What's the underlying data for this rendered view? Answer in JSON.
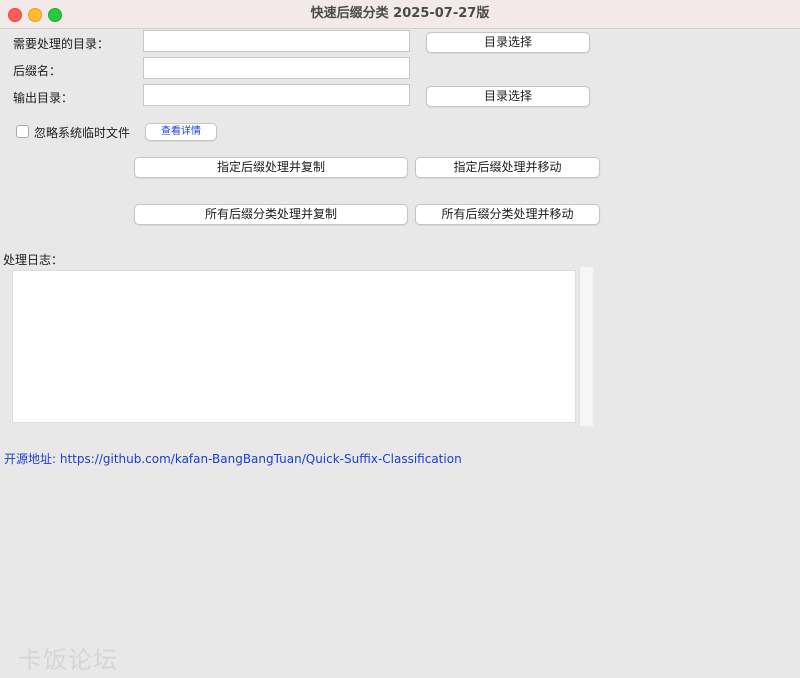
{
  "window": {
    "title": "快速后缀分类 2025-07-27版"
  },
  "form": {
    "source_dir_label": "需要处理的目录：",
    "source_dir_value": "",
    "source_dir_button": "目录选择",
    "suffix_label": "后缀名：",
    "suffix_value": "",
    "output_dir_label": "输出目录：",
    "output_dir_value": "",
    "output_dir_button": "目录选择",
    "ignore_temp_label": "忽略系统临时文件",
    "ignore_temp_checked": false,
    "details_button": "查看详情"
  },
  "actions": {
    "copy_specified": "指定后缀处理并复制",
    "move_specified": "指定后缀处理并移动",
    "copy_all": "所有后缀分类处理并复制",
    "move_all": "所有后缀分类处理并移动"
  },
  "log": {
    "label": "处理日志：",
    "content": ""
  },
  "footer": {
    "link_text": "开源地址: https://github.com/kafan-BangBangTuan/Quick-Suffix-Classification"
  },
  "watermark": {
    "text": "卡饭论坛"
  },
  "colors": {
    "link": "#1a3fd6",
    "close": "#ff5f57",
    "minimize": "#febc2e",
    "maximize": "#28c840"
  }
}
